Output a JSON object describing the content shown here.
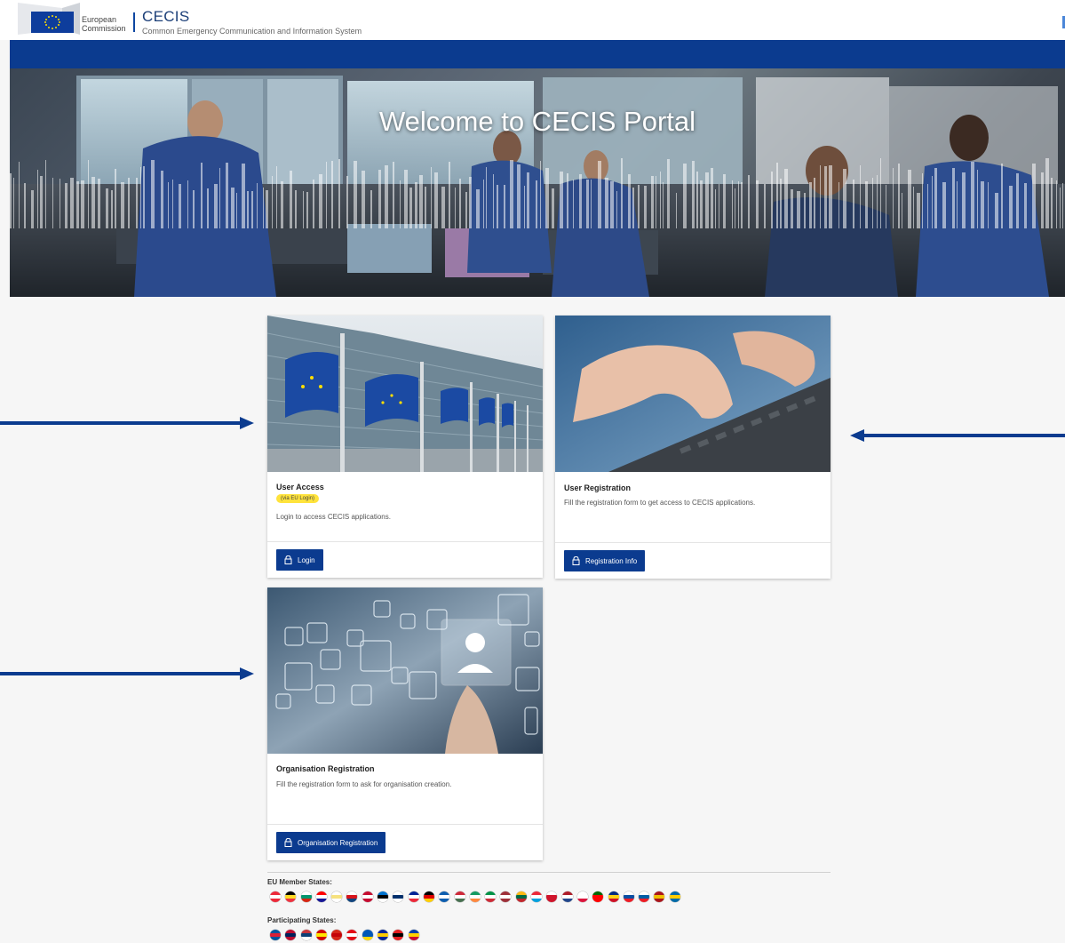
{
  "header": {
    "logo_line1": "European",
    "logo_line2": "Commission",
    "app_title": "CECIS",
    "app_subtitle": "Common Emergency Communication and Information System"
  },
  "hero": {
    "title": "Welcome to CECIS Portal"
  },
  "cards": {
    "user_access": {
      "title": "User Access",
      "badge": "(via EU Login)",
      "description": "Login to access CECIS applications.",
      "button_label": "Login"
    },
    "user_registration": {
      "title": "User Registration",
      "description": "Fill the registration form to get access to CECIS applications.",
      "button_label": "Registration Info"
    },
    "organisation_registration": {
      "title": "Organisation Registration",
      "description": "Fill the registration form to ask for organisation creation.",
      "button_label": "Organisation Registration"
    }
  },
  "states": {
    "eu_label": "EU Member States:",
    "participating_label": "Participating States:",
    "eu_flags": [
      [
        "#ed2939",
        "#ffffff",
        "#ed2939"
      ],
      [
        "#000000",
        "#fdda24",
        "#ef3340"
      ],
      [
        "#ffffff",
        "#00966e",
        "#d62612"
      ],
      [
        "#ff0000",
        "#ffffff",
        "#171796"
      ],
      [
        "#ffffff",
        "#f6e27f",
        "#ffffff"
      ],
      [
        "#ffffff",
        "#d7141a",
        "#11457e"
      ],
      [
        "#c60c30",
        "#ffffff",
        "#c60c30"
      ],
      [
        "#0072ce",
        "#000000",
        "#ffffff"
      ],
      [
        "#ffffff",
        "#002f6c",
        "#ffffff"
      ],
      [
        "#002395",
        "#ffffff",
        "#ed2939"
      ],
      [
        "#000000",
        "#dd0000",
        "#ffce00"
      ],
      [
        "#0d5eaf",
        "#ffffff",
        "#0d5eaf"
      ],
      [
        "#ce2939",
        "#ffffff",
        "#477050"
      ],
      [
        "#169b62",
        "#ffffff",
        "#ff883e"
      ],
      [
        "#009246",
        "#ffffff",
        "#ce2b37"
      ],
      [
        "#9e3039",
        "#ffffff",
        "#9e3039"
      ],
      [
        "#fdb913",
        "#006a44",
        "#c1272d"
      ],
      [
        "#ed2939",
        "#ffffff",
        "#00a1de"
      ],
      [
        "#ffffff",
        "#cf142b",
        "#cf142b"
      ],
      [
        "#ae1c28",
        "#ffffff",
        "#21468b"
      ],
      [
        "#ffffff",
        "#ffffff",
        "#dc143c"
      ],
      [
        "#006600",
        "#ff0000",
        "#ff0000"
      ],
      [
        "#002b7f",
        "#fcd116",
        "#ce1126"
      ],
      [
        "#ffffff",
        "#0b4ea2",
        "#ee1c25"
      ],
      [
        "#ffffff",
        "#005da4",
        "#ed1c24"
      ],
      [
        "#aa151b",
        "#f1bf00",
        "#aa151b"
      ],
      [
        "#006aa7",
        "#fecc00",
        "#006aa7"
      ]
    ],
    "participating_flags": [
      [
        "#02529c",
        "#dc1e35",
        "#02529c"
      ],
      [
        "#ba0c2f",
        "#00205b",
        "#ba0c2f"
      ],
      [
        "#c6363c",
        "#0c4076",
        "#ffffff"
      ],
      [
        "#d20000",
        "#ffe600",
        "#d20000"
      ],
      [
        "#d62718",
        "#c40308",
        "#d62718"
      ],
      [
        "#e30a17",
        "#ffffff",
        "#e30a17"
      ],
      [
        "#0057b7",
        "#0057b7",
        "#ffd700"
      ],
      [
        "#002395",
        "#fecb00",
        "#002395"
      ],
      [
        "#e41e20",
        "#000000",
        "#e41e20"
      ],
      [
        "#003da5",
        "#ffd100",
        "#cc092f"
      ]
    ]
  }
}
